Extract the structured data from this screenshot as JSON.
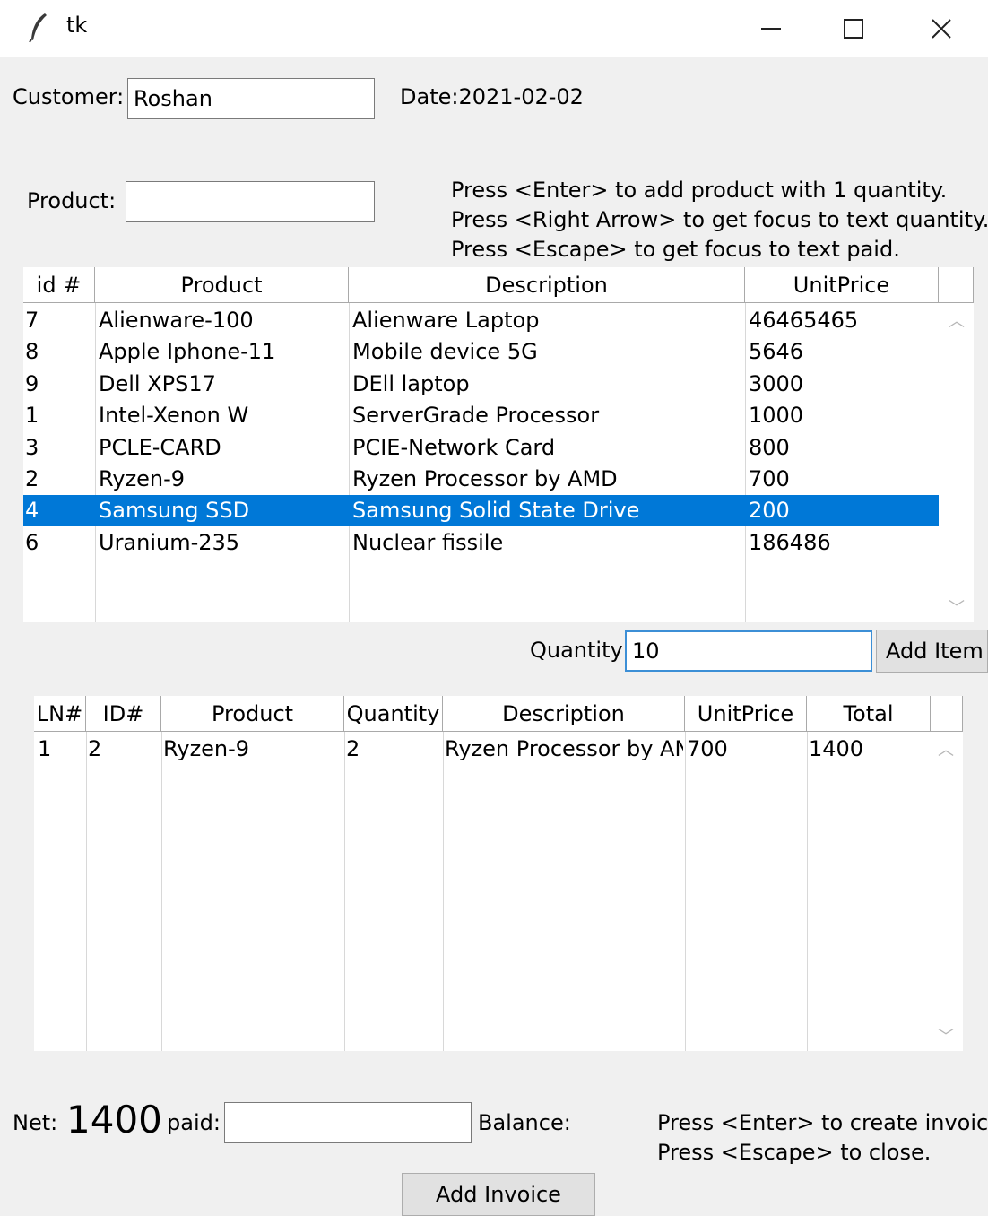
{
  "window": {
    "title": "tk",
    "icon": "feather-icon",
    "minimize": "—",
    "maximize": "☐",
    "close": "✕"
  },
  "header": {
    "customer_label": "Customer:",
    "customer_value": "Roshan",
    "date_text": "Date:2021-02-02",
    "product_label": "Product:",
    "product_value": "",
    "hints": [
      "Press <Enter> to add product with 1 quantity.",
      "Press <Right Arrow> to get focus to text quantity.",
      "Press <Escape> to get focus to text paid."
    ]
  },
  "products_table": {
    "columns": [
      "id #",
      "Product",
      "Description",
      "UnitPrice"
    ],
    "selected_index": 6,
    "rows": [
      [
        "7",
        "Alienware-100",
        "Alienware Laptop",
        "46465465"
      ],
      [
        "8",
        "Apple Iphone-11",
        "Mobile device 5G",
        "5646"
      ],
      [
        "9",
        "Dell XPS17",
        "DEll laptop",
        "3000"
      ],
      [
        "1",
        "Intel-Xenon W",
        "ServerGrade Processor",
        "1000"
      ],
      [
        "3",
        "PCLE-CARD",
        "PCIE-Network Card",
        "800"
      ],
      [
        "2",
        "Ryzen-9",
        "Ryzen Processor by AMD",
        "700"
      ],
      [
        "4",
        "Samsung SSD",
        "Samsung Solid State Drive",
        "200"
      ],
      [
        "6",
        "Uranium-235",
        "Nuclear fissile",
        "186486"
      ]
    ]
  },
  "quantity": {
    "label": "Quantity",
    "value": "10",
    "add_button": "Add Item"
  },
  "invoice_table": {
    "columns": [
      "LN#",
      "ID#",
      "Product",
      "Quantity",
      "Description",
      "UnitPrice",
      "Total"
    ],
    "rows": [
      [
        "1",
        "2",
        "Ryzen-9",
        "2",
        "Ryzen Processor by AN",
        "700",
        "1400"
      ]
    ]
  },
  "footer": {
    "net_label": "Net:",
    "net_value": "1400",
    "paid_label": "paid:",
    "paid_value": "",
    "balance_label": "Balance:",
    "hints": [
      "Press <Enter> to create invoice.",
      "Press <Escape> to close."
    ],
    "add_invoice": "Add Invoice"
  }
}
